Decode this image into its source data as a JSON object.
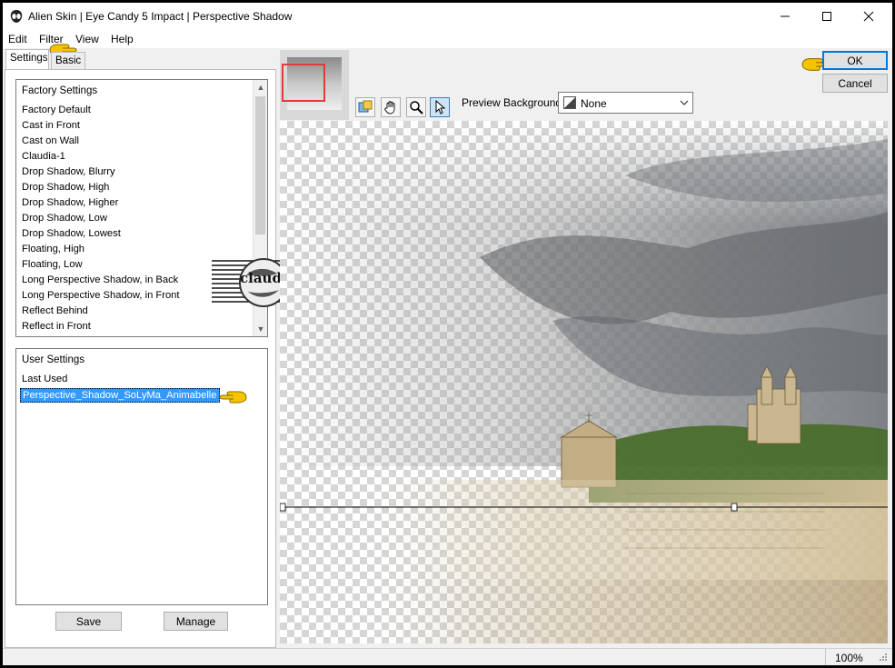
{
  "window": {
    "title": "Alien Skin | Eye Candy 5 Impact | Perspective Shadow",
    "minimize_icon": "minimize-icon",
    "maximize_icon": "maximize-icon",
    "close_icon": "close-icon"
  },
  "menu": {
    "items": [
      "Edit",
      "Filter",
      "View",
      "Help"
    ]
  },
  "tabs": {
    "settings": "Settings",
    "basic": "Basic"
  },
  "factory_settings": {
    "header": "Factory Settings",
    "items": [
      "Factory Default",
      "Cast in Front",
      "Cast on Wall",
      "Claudia-1",
      "Drop Shadow, Blurry",
      "Drop Shadow, High",
      "Drop Shadow, Higher",
      "Drop Shadow, Low",
      "Drop Shadow, Lowest",
      "Floating, High",
      "Floating, Low",
      "Long Perspective Shadow, in Back",
      "Long Perspective Shadow, in Front",
      "Reflect Behind",
      "Reflect in Front"
    ]
  },
  "user_settings": {
    "header": "User Settings",
    "items": [
      "Last Used",
      "Perspective_Shadow_SoLyMa_Animabelle"
    ],
    "selected_index": 1
  },
  "buttons": {
    "save": "Save",
    "manage": "Manage",
    "ok": "OK",
    "cancel": "Cancel"
  },
  "toolbar": {
    "tools": [
      "navigator-icon",
      "hand-pan-icon",
      "zoom-icon",
      "pointer-icon"
    ],
    "active_tool": "pointer-icon"
  },
  "preview_background": {
    "label": "Preview Background:",
    "value": "None"
  },
  "watermark": {
    "text": "claudia"
  },
  "status": {
    "zoom": "100%"
  },
  "colors": {
    "selection": "#3399ff",
    "accent": "#0078d7",
    "pointer_hand": "#f5c400"
  }
}
